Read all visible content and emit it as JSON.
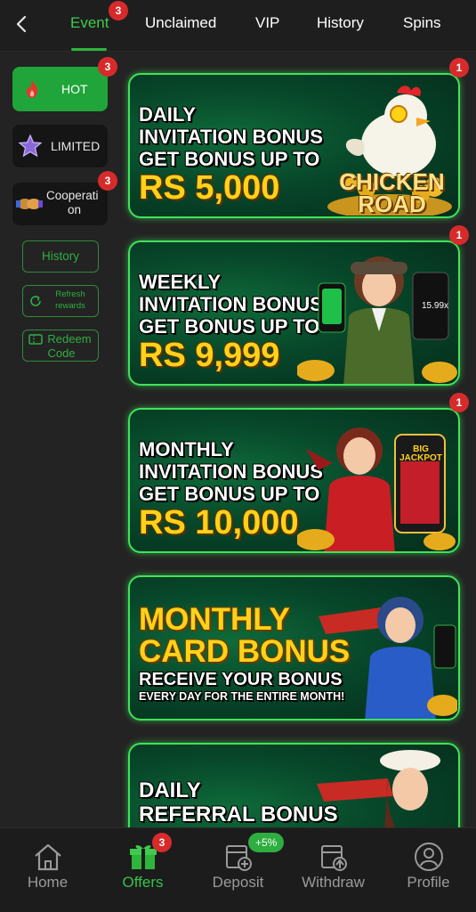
{
  "tabs": [
    {
      "label": "Event",
      "badge": "3"
    },
    {
      "label": "Unclaimed"
    },
    {
      "label": "VIP"
    },
    {
      "label": "History"
    },
    {
      "label": "Spins"
    }
  ],
  "sidebar": {
    "hot": {
      "label": "HOT",
      "badge": "3"
    },
    "limited": {
      "label": "LIMITED"
    },
    "coop": {
      "label_line1": "Cooperati",
      "label_line2": "on",
      "badge": "3"
    },
    "history": "History",
    "refresh": {
      "line1": "Refresh",
      "line2": "rewards"
    },
    "redeem": {
      "line1": "Redeem",
      "line2": "Code"
    }
  },
  "banners": [
    {
      "lines": [
        "DAILY",
        "INVITATION BONUS",
        "GET BONUS UP TO"
      ],
      "amount": "RS 5,000",
      "badge": "1",
      "art_text": "CHICKEN ROAD"
    },
    {
      "lines": [
        "WEEKLY",
        "INVITATION BONUS",
        "GET BONUS UP TO"
      ],
      "amount": "RS 9,999",
      "badge": "1",
      "art_text": "15.99x"
    },
    {
      "lines": [
        "MONTHLY",
        "INVITATION BONUS",
        "GET BONUS UP TO"
      ],
      "amount": "RS 10,000",
      "badge": "1",
      "art_text": "BIG JACKPOT"
    },
    {
      "title1": "MONTHLY",
      "title2": "CARD BONUS",
      "sub1": "RECEIVE YOUR BONUS",
      "sub2": "EVERY DAY FOR THE ENTIRE MONTH!"
    },
    {
      "lines": [
        "DAILY",
        "REFERRAL BONUS"
      ]
    }
  ],
  "bottom_nav": [
    {
      "label": "Home",
      "icon": "home-icon"
    },
    {
      "label": "Offers",
      "icon": "gift-icon",
      "badge": "3"
    },
    {
      "label": "Deposit",
      "icon": "deposit-icon",
      "pill": "+5%"
    },
    {
      "label": "Withdraw",
      "icon": "withdraw-icon"
    },
    {
      "label": "Profile",
      "icon": "profile-icon"
    }
  ],
  "colors": {
    "accent": "#2fb43e",
    "badge": "#d72b2b",
    "gold": "#ffd21a",
    "banner_border": "#3fe35a"
  }
}
